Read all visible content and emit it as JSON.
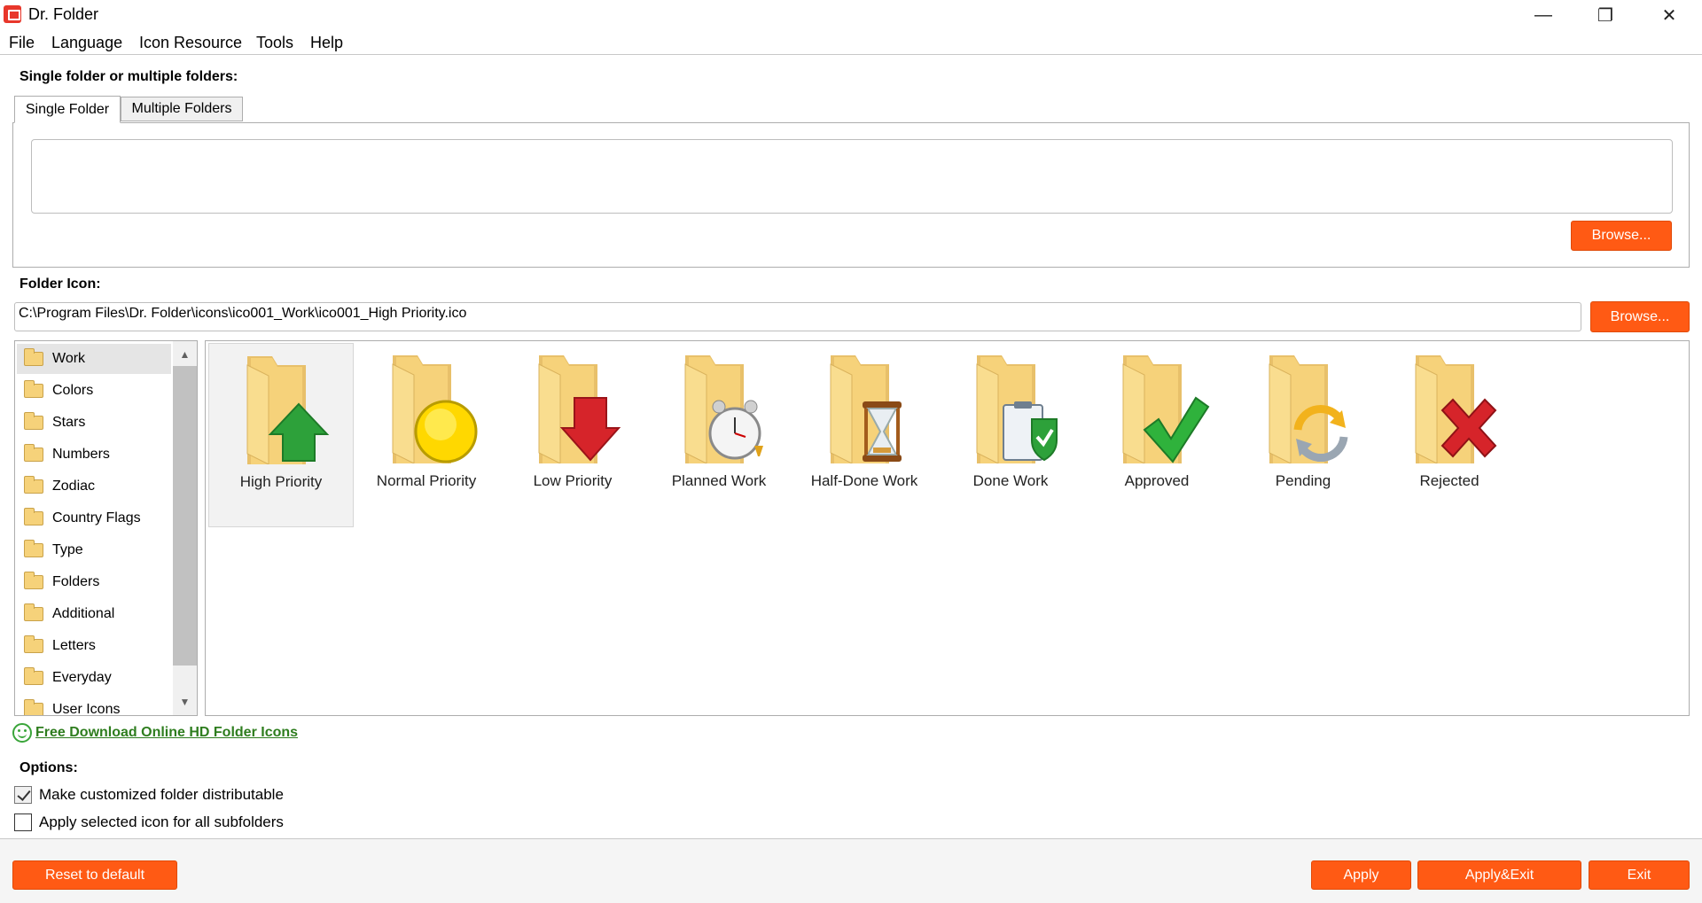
{
  "window": {
    "title": "Dr. Folder",
    "minimize": "—",
    "maximize": "❐",
    "close": "✕"
  },
  "menu": [
    "File",
    "Language",
    "Icon Resource",
    "Tools",
    "Help"
  ],
  "folder_section": {
    "label": "Single folder or multiple folders:",
    "tabs": [
      "Single Folder",
      "Multiple Folders"
    ],
    "active_tab": "Single Folder",
    "folder_value": "",
    "browse_label": "Browse..."
  },
  "icon_section": {
    "label": "Folder Icon:",
    "path_value": "C:\\Program Files\\Dr. Folder\\icons\\ico001_Work\\ico001_High Priority.ico",
    "browse_label": "Browse..."
  },
  "categories": {
    "items": [
      "Work",
      "Colors",
      "Stars",
      "Numbers",
      "Zodiac",
      "Country Flags",
      "Type",
      "Folders",
      "Additional",
      "Letters",
      "Everyday",
      "User Icons"
    ],
    "selected": "Work"
  },
  "icons": [
    {
      "label": "High Priority",
      "overlay": "arrow-up-green-icon",
      "selected": true
    },
    {
      "label": "Normal Priority",
      "overlay": "yellow-circle-icon",
      "selected": false
    },
    {
      "label": "Low Priority",
      "overlay": "arrow-down-red-icon",
      "selected": false
    },
    {
      "label": "Planned Work",
      "overlay": "alarm-clock-icon",
      "selected": false
    },
    {
      "label": "Half-Done Work",
      "overlay": "hourglass-icon",
      "selected": false
    },
    {
      "label": "Done Work",
      "overlay": "clipboard-check-icon",
      "selected": false
    },
    {
      "label": "Approved",
      "overlay": "green-check-icon",
      "selected": false
    },
    {
      "label": "Pending",
      "overlay": "refresh-arrows-icon",
      "selected": false
    },
    {
      "label": "Rejected",
      "overlay": "red-x-icon",
      "selected": false
    }
  ],
  "download_link": "Free Download Online HD Folder Icons",
  "options": {
    "label": "Options:",
    "make_distributable": {
      "label": "Make customized folder distributable",
      "checked": true
    },
    "apply_subfolders": {
      "label": "Apply selected icon for all subfolders",
      "checked": false
    }
  },
  "buttons": {
    "reset": "Reset to default",
    "apply": "Apply",
    "apply_exit": "Apply&Exit",
    "exit": "Exit"
  },
  "colors": {
    "accent": "#ff5a14",
    "link": "#2e7d1e",
    "folder": "#f6d27a"
  }
}
